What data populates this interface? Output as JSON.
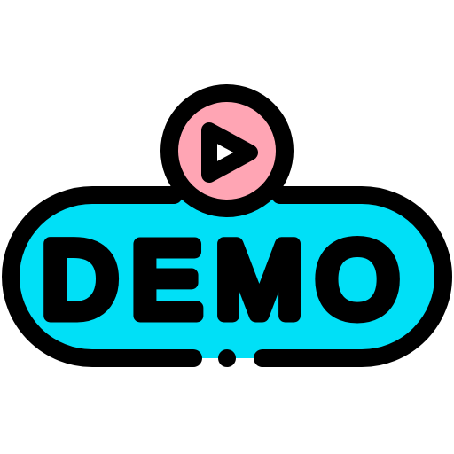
{
  "badge": {
    "text": "DEMO",
    "icons": {
      "play": "play-icon"
    },
    "colors": {
      "pill_fill": "#00E0F7",
      "circle_fill": "#FFA5B4",
      "outline": "#000000",
      "play_fill": "#FFFFFF",
      "background": "#FFFFFF"
    }
  }
}
